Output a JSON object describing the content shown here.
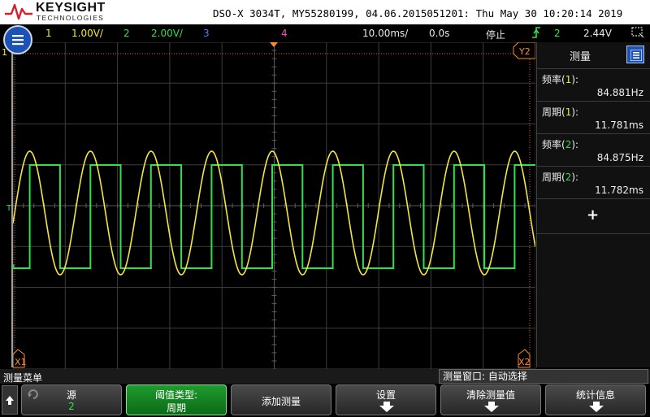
{
  "title_bar": {
    "brand": "KEYSIGHT",
    "brand_sub": "TECHNOLOGIES",
    "title": "DSO-X 3034T, MY55280199, 04.06.2015051201: Thu May 30 10:20:14 2019"
  },
  "status_bar": {
    "ch1_num": "1",
    "ch1_scale": "1.00V/",
    "ch2_num": "2",
    "ch2_scale": "2.00V/",
    "ch3_num": "3",
    "ch4_num": "4",
    "timebase": "10.00ms/",
    "delay": "0.0s",
    "run_state": "停止",
    "trigger_icon": "trigger-rising-edge-icon",
    "trigger_source": "2",
    "trigger_level": "2.44V"
  },
  "graticule": {
    "channel_label": "1",
    "ch2_marker": "2",
    "trigger_marker": "T",
    "cursor_x1": "X1",
    "cursor_x2": "X2",
    "cursor_y2": "Y2"
  },
  "measurements_panel": {
    "title": "测量",
    "items": [
      {
        "label": "频率",
        "source": "1",
        "value": "84.881Hz",
        "source_color": "#f2e642"
      },
      {
        "label": "周期",
        "source": "1",
        "value": "11.781ms",
        "source_color": "#f2e642"
      },
      {
        "label": "频率",
        "source": "2",
        "value": "84.875Hz",
        "source_color": "#2ee24a"
      },
      {
        "label": "周期",
        "source": "2",
        "value": "11.782ms",
        "source_color": "#2ee24a"
      }
    ],
    "add_symbol": "+"
  },
  "softkey_menu": {
    "menu_title": "测量菜单",
    "window_info": "测量窗口: 自动选择",
    "keys": [
      {
        "line1": "源",
        "line2": "2"
      },
      {
        "line1": "阈值类型:",
        "line2": "周期"
      },
      {
        "label": "添加测量"
      },
      {
        "label": "设置"
      },
      {
        "label": "清除测量值"
      },
      {
        "label": "统计信息"
      }
    ]
  },
  "colors": {
    "ch1": "#f2e642",
    "ch2": "#2ee24a",
    "ch3": "#4f7dff",
    "ch4": "#ff49b7",
    "accent": "#1c52b5",
    "trigger_marker": "#ff8a2a"
  }
}
